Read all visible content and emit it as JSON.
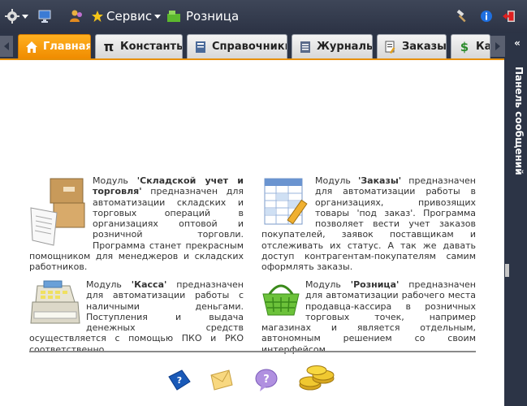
{
  "topbar": {
    "service_label": "Сервис",
    "retail_label": "Розница"
  },
  "tabs": [
    {
      "label": "Главная",
      "icon": "home-icon"
    },
    {
      "label": "Константы",
      "icon": "pi-icon"
    },
    {
      "label": "Справочники",
      "icon": "book-icon"
    },
    {
      "label": "Журналы",
      "icon": "journal-icon"
    },
    {
      "label": "Заказы",
      "icon": "orders-icon"
    },
    {
      "label": "Кас",
      "icon": "dollar-icon"
    }
  ],
  "right_panel": {
    "title": "Панель сообщений"
  },
  "modules": {
    "warehouse": {
      "prefix": "Модуль ",
      "name": "'Складской учет и торговля'",
      "text": " предназначен для автоматизации складских и торговых операций в организациях оптовой и розничной торговли. Программа станет прекрасным помощником для менеджеров и складских работников."
    },
    "orders": {
      "prefix": "Модуль ",
      "name": "'Заказы'",
      "text": " предназначен для автоматизации работы в организациях, привозящих товары 'под заказ'. Программа позволяет вести учет заказов покупателей, заявок поставщикам и отслеживать их статус. А так же давать доступ контрагентам-покупателям самим оформлять заказы."
    },
    "cash": {
      "prefix": "Модуль ",
      "name": "'Касса'",
      "text": " предназначен для автоматизации работы с наличными деньгами. Поступления и выдача денежных средств осуществляется с помощью ПКО и РКО соответственно."
    },
    "retail": {
      "prefix": "Модуль ",
      "name": "'Розница'",
      "text": " предназначен для автоматизации рабочего места продавца-кассира в розничных торговых точек, например магазинах и является отдельным, автономным решением со своим интерфейсом."
    }
  },
  "colors": {
    "accent": "#f08c00",
    "topbar": "#2c3446"
  }
}
